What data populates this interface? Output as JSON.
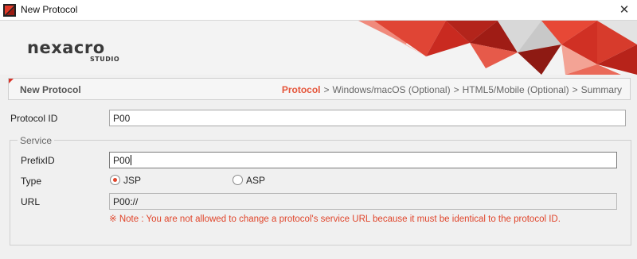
{
  "window": {
    "title": "New Protocol",
    "close": "✕"
  },
  "logo": {
    "main": "nexacro",
    "sub": "STUDIO"
  },
  "stepbar": {
    "title": "New Protocol",
    "steps": [
      "Protocol",
      "Windows/macOS (Optional)",
      "HTML5/Mobile (Optional)",
      "Summary"
    ],
    "active_step": "Protocol",
    "separator": ">"
  },
  "form": {
    "protocol_id_label": "Protocol ID",
    "protocol_id_value": "P00",
    "service_group_label": "Service",
    "prefix_id_label": "PrefixID",
    "prefix_id_value": "P00",
    "type_label": "Type",
    "type_options": [
      "JSP",
      "ASP"
    ],
    "type_selected": "JSP",
    "url_label": "URL",
    "url_value": "P00://",
    "note": "※ Note : You are not allowed to change a protocol's service URL because it must be identical to the protocol ID."
  },
  "colors": {
    "accent": "#e0452b",
    "step_active": "#e5553a",
    "banner_red": "#d9352a"
  }
}
